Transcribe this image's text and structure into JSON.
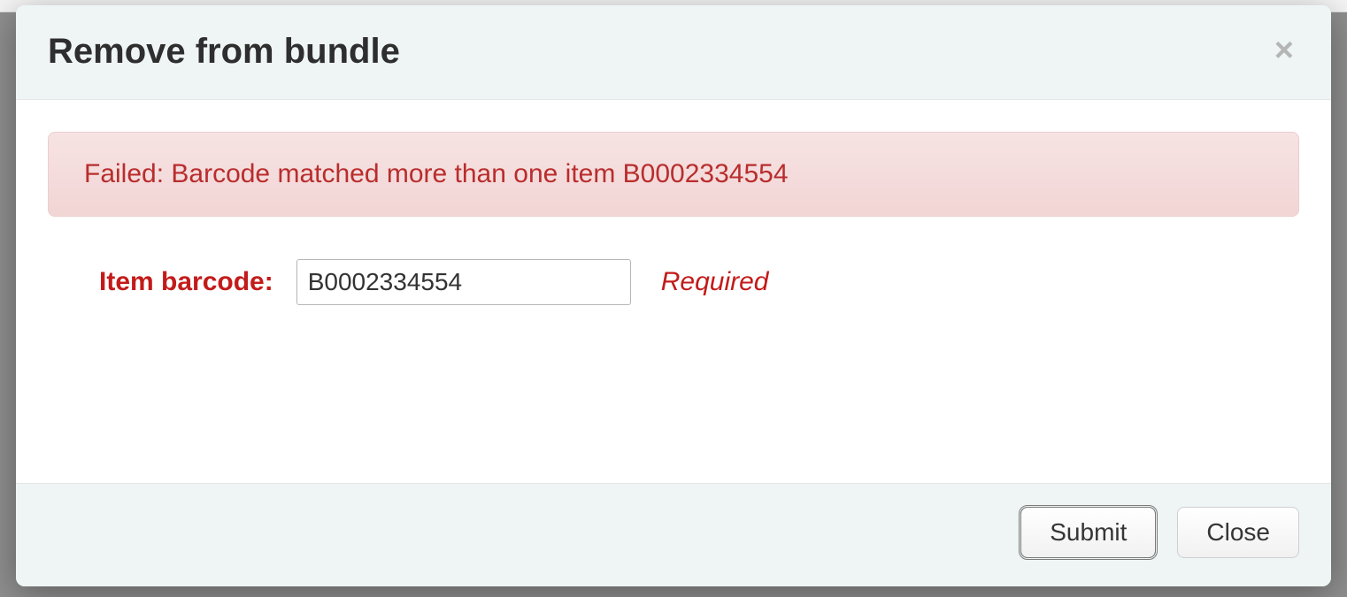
{
  "modal": {
    "title": "Remove from bundle",
    "close_label": "×"
  },
  "alert": {
    "message": "Failed: Barcode matched more than one item B0002334554"
  },
  "form": {
    "barcode_label": "Item barcode:",
    "barcode_value": "B0002334554",
    "required_hint": "Required"
  },
  "footer": {
    "submit_label": "Submit",
    "close_label": "Close"
  }
}
